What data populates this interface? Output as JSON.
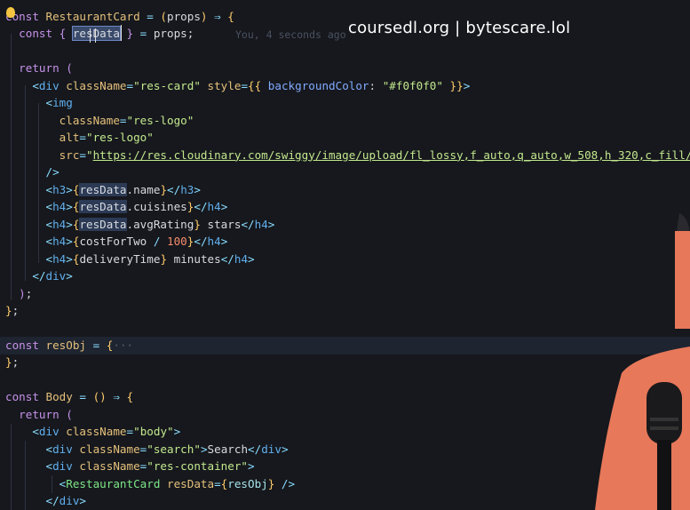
{
  "watermark": "coursedl.org | bytescare.lol",
  "blame": "You, 4 seconds ago",
  "code": [
    [
      [
        "const ",
        "kw"
      ],
      [
        "RestaurantCard",
        "var"
      ],
      [
        " = ",
        "op"
      ],
      [
        "(",
        "br"
      ],
      [
        "props",
        "pn"
      ],
      [
        ")",
        "br"
      ],
      [
        " ⇒ ",
        "op"
      ],
      [
        "{",
        "br"
      ]
    ],
    [
      [
        "  const ",
        "kw"
      ],
      [
        "{ ",
        "br2"
      ],
      [
        "resData",
        "sel"
      ],
      [
        " }",
        "br2"
      ],
      [
        " = ",
        "op"
      ],
      [
        "props;",
        "pn"
      ]
    ],
    [
      [
        "",
        ""
      ]
    ],
    [
      [
        "  return ",
        "kw"
      ],
      [
        "(",
        "br2"
      ]
    ],
    [
      [
        "    <",
        "tag"
      ],
      [
        "div ",
        "tagn"
      ],
      [
        "className",
        "attr"
      ],
      [
        "=",
        "op"
      ],
      [
        "\"res-card\"",
        "str"
      ],
      [
        " style",
        "attr"
      ],
      [
        "=",
        "op"
      ],
      [
        "{{",
        "br"
      ],
      [
        " backgroundColor",
        "prop"
      ],
      [
        ": ",
        "pn"
      ],
      [
        "\"#f0f0f0\"",
        "str"
      ],
      [
        " }}",
        "br"
      ],
      [
        ">",
        "tag"
      ]
    ],
    [
      [
        "      <",
        "tag"
      ],
      [
        "img",
        "tagn"
      ]
    ],
    [
      [
        "        className",
        "attr"
      ],
      [
        "=",
        "op"
      ],
      [
        "\"res-logo\"",
        "str"
      ]
    ],
    [
      [
        "        alt",
        "attr"
      ],
      [
        "=",
        "op"
      ],
      [
        "\"res-logo\"",
        "str"
      ]
    ],
    [
      [
        "        src",
        "attr"
      ],
      [
        "=",
        "op"
      ],
      [
        "\"",
        "str"
      ],
      [
        "https://res.cloudinary.com/swiggy/image/upload/fl_lossy,f_auto,q_auto,w_508,h_320,c_fill/",
        "url"
      ]
    ],
    [
      [
        "      />",
        "tag"
      ]
    ],
    [
      [
        "      <",
        "tag"
      ],
      [
        "h3",
        "tagn"
      ],
      [
        ">",
        "tag"
      ],
      [
        "{",
        "br"
      ],
      [
        "resData",
        "sel2"
      ],
      [
        ".name",
        "pn"
      ],
      [
        "}",
        "br"
      ],
      [
        "</",
        "tag"
      ],
      [
        "h3",
        "tagn"
      ],
      [
        ">",
        "tag"
      ]
    ],
    [
      [
        "      <",
        "tag"
      ],
      [
        "h4",
        "tagn"
      ],
      [
        ">",
        "tag"
      ],
      [
        "{",
        "br"
      ],
      [
        "resData",
        "sel2"
      ],
      [
        ".cuisines",
        "pn"
      ],
      [
        "}",
        "br"
      ],
      [
        "</",
        "tag"
      ],
      [
        "h4",
        "tagn"
      ],
      [
        ">",
        "tag"
      ]
    ],
    [
      [
        "      <",
        "tag"
      ],
      [
        "h4",
        "tagn"
      ],
      [
        ">",
        "tag"
      ],
      [
        "{",
        "br"
      ],
      [
        "resData",
        "sel2"
      ],
      [
        ".avgRating",
        "pn"
      ],
      [
        "}",
        "br"
      ],
      [
        " stars",
        "pn"
      ],
      [
        "</",
        "tag"
      ],
      [
        "h4",
        "tagn"
      ],
      [
        ">",
        "tag"
      ]
    ],
    [
      [
        "      <",
        "tag"
      ],
      [
        "h4",
        "tagn"
      ],
      [
        ">",
        "tag"
      ],
      [
        "{",
        "br"
      ],
      [
        "costForTwo",
        "pn"
      ],
      [
        " / ",
        "op"
      ],
      [
        "100",
        "num"
      ],
      [
        "}",
        "br"
      ],
      [
        "</",
        "tag"
      ],
      [
        "h4",
        "tagn"
      ],
      [
        ">",
        "tag"
      ]
    ],
    [
      [
        "      <",
        "tag"
      ],
      [
        "h4",
        "tagn"
      ],
      [
        ">",
        "tag"
      ],
      [
        "{",
        "br"
      ],
      [
        "deliveryTime",
        "pn"
      ],
      [
        "}",
        "br"
      ],
      [
        " minutes",
        "pn"
      ],
      [
        "</",
        "tag"
      ],
      [
        "h4",
        "tagn"
      ],
      [
        ">",
        "tag"
      ]
    ],
    [
      [
        "    </",
        "tag"
      ],
      [
        "div",
        "tagn"
      ],
      [
        ">",
        "tag"
      ]
    ],
    [
      [
        "  )",
        "br2"
      ],
      [
        ";",
        "pn"
      ]
    ],
    [
      [
        "}",
        "br"
      ],
      [
        ";",
        "pn"
      ]
    ],
    [
      [
        "",
        ""
      ]
    ],
    [
      [
        "const ",
        "kw"
      ],
      [
        "resObj",
        "var"
      ],
      [
        " = ",
        "op"
      ],
      [
        "{",
        "br"
      ],
      [
        "···",
        "muted"
      ]
    ],
    [
      [
        "}",
        "br"
      ],
      [
        ";",
        "pn"
      ]
    ],
    [
      [
        "",
        ""
      ]
    ],
    [
      [
        "const ",
        "kw"
      ],
      [
        "Body",
        "var"
      ],
      [
        " = ",
        "op"
      ],
      [
        "()",
        "br"
      ],
      [
        " ⇒ ",
        "op"
      ],
      [
        "{",
        "br"
      ]
    ],
    [
      [
        "  return ",
        "kw"
      ],
      [
        "(",
        "br2"
      ]
    ],
    [
      [
        "    <",
        "tag"
      ],
      [
        "div ",
        "tagn"
      ],
      [
        "className",
        "attr"
      ],
      [
        "=",
        "op"
      ],
      [
        "\"body\"",
        "str"
      ],
      [
        ">",
        "tag"
      ]
    ],
    [
      [
        "      <",
        "tag"
      ],
      [
        "div ",
        "tagn"
      ],
      [
        "className",
        "attr"
      ],
      [
        "=",
        "op"
      ],
      [
        "\"search\"",
        "str"
      ],
      [
        ">",
        "tag"
      ],
      [
        "Search",
        "pn"
      ],
      [
        "</",
        "tag"
      ],
      [
        "div",
        "tagn"
      ],
      [
        ">",
        "tag"
      ]
    ],
    [
      [
        "      <",
        "tag"
      ],
      [
        "div ",
        "tagn"
      ],
      [
        "className",
        "attr"
      ],
      [
        "=",
        "op"
      ],
      [
        "\"res-container\"",
        "str"
      ],
      [
        ">",
        "tag"
      ]
    ],
    [
      [
        "        <",
        "tag"
      ],
      [
        "RestaurantCard ",
        "comp"
      ],
      [
        "resData",
        "attr"
      ],
      [
        "=",
        "op"
      ],
      [
        "{",
        "br"
      ],
      [
        "resObj",
        "id"
      ],
      [
        "}",
        "br"
      ],
      [
        " />",
        "tag"
      ]
    ],
    [
      [
        "      </",
        "tag"
      ],
      [
        "div",
        "tagn"
      ],
      [
        ">",
        "tag"
      ]
    ]
  ],
  "colors": {
    "background": "#16181d",
    "skin": "#e8785a",
    "hair": "#2a2a2e"
  }
}
